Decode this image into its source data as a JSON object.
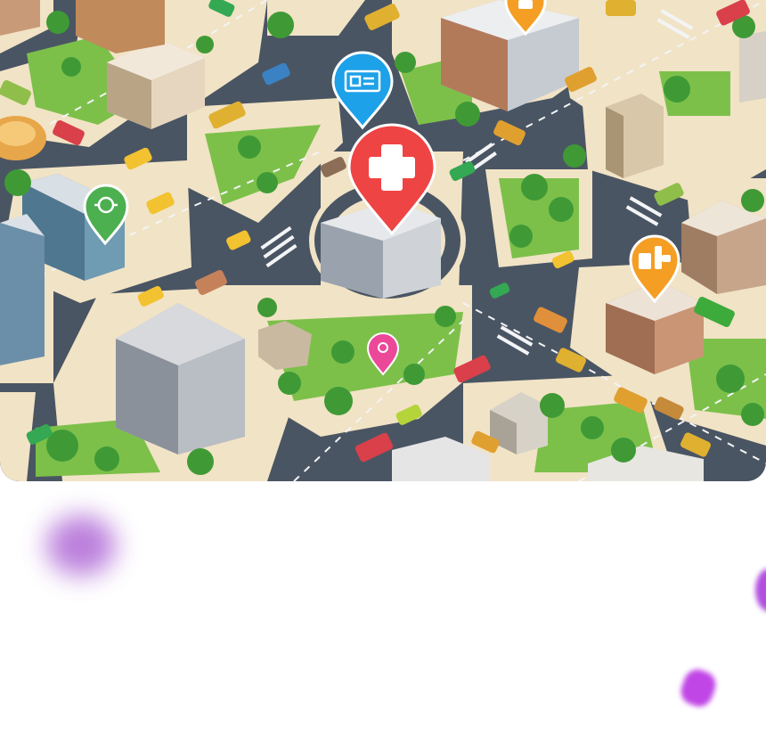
{
  "hero": {
    "pins": [
      {
        "name": "hospital-pin",
        "color": "#ef4444",
        "icon": "cross-icon"
      },
      {
        "name": "bank-pin",
        "color": "#1da1e8",
        "icon": "atm-card-icon"
      },
      {
        "name": "park-pin",
        "color": "#4caf50",
        "icon": "leaf-icon"
      },
      {
        "name": "restaurant-pin",
        "color": "#f59e24",
        "icon": "fork-knife-icon"
      },
      {
        "name": "shop-pin",
        "color": "#f59e24",
        "icon": "bag-icon"
      },
      {
        "name": "cafe-pin",
        "color": "#ec4899",
        "icon": "cup-icon"
      }
    ]
  },
  "colors": {
    "road": "#4a5563",
    "sidewalk": "#f1e3c5",
    "grass": "#7cc04a",
    "tree": "#3f9a36",
    "accent_purple": "#b24fe0"
  }
}
